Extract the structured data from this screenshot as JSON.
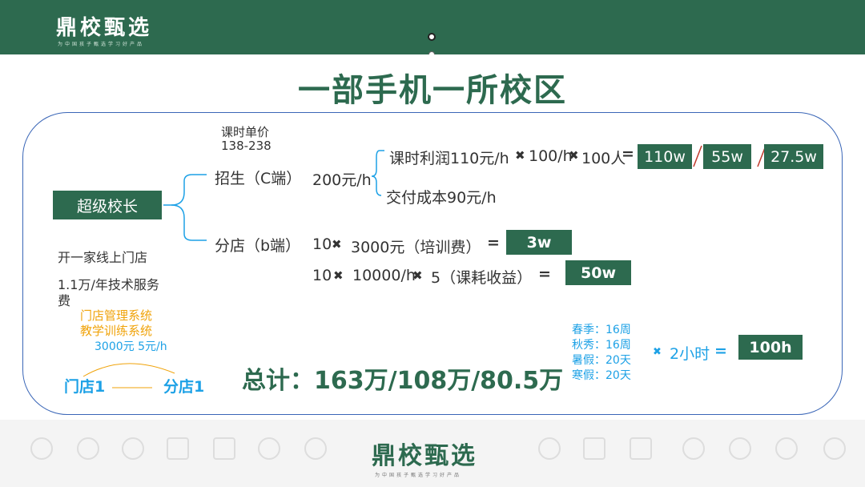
{
  "header": {
    "logo": "鼎校甄选",
    "tagline": "为中国孩子甄选学习好产品"
  },
  "title": "一部手机一所校区",
  "super_principal": "超级校长",
  "class_price": {
    "label": "课时单价",
    "range": "138-238"
  },
  "c_end": {
    "label": "招生（C端）",
    "price": "200元/h",
    "profit": "课时利润110元/h",
    "mult1": "✖",
    "rate": "100/h",
    "mult2": "✖",
    "people": "100人",
    "equals": "=",
    "cost": "交付成本90元/h",
    "results": [
      "110w",
      "55w",
      "27.5w"
    ]
  },
  "b_end": {
    "label": "分店（b端）",
    "line1_a": "10",
    "mult": "✖",
    "line1_b": "3000元（培训费）",
    "line1_eq": "=",
    "line1_result": "3w",
    "line2_a": "10",
    "line2_b": "10000/h",
    "line2_c": "5（课耗收益）",
    "line2_eq": "=",
    "line2_result": "50w"
  },
  "left_notes": {
    "online_store": "开一家线上门店",
    "fee_line1": "1.1万/年技术服务",
    "fee_line2": "费",
    "system1": "门店管理系统",
    "system2": "教学训练系统",
    "prices": "3000元  5元/h",
    "store1": "门店1",
    "branch1": "分店1"
  },
  "seasons": [
    "春季：16周",
    "秋秀：16周",
    "暑假：20天",
    "寒假：20天"
  ],
  "hours": {
    "mult": "✖",
    "label": "2小时",
    "equals": "=",
    "result": "100h"
  },
  "total": "总计：163万/108万/80.5万",
  "footer": {
    "logo": "鼎校甄选",
    "tagline": "为中国孩子甄选学习好产品",
    "icons": [
      "medal-icon",
      "bulb-icon",
      "search-icon",
      "ruler-icon",
      "document-icon",
      "globe-icon",
      "bulb-icon",
      "globe-icon",
      "medal-icon"
    ]
  },
  "colors": {
    "brand_green": "#2d6a4f",
    "frame_blue": "#3a66b7",
    "orange": "#f0a30a",
    "light_blue": "#1da1e6"
  }
}
